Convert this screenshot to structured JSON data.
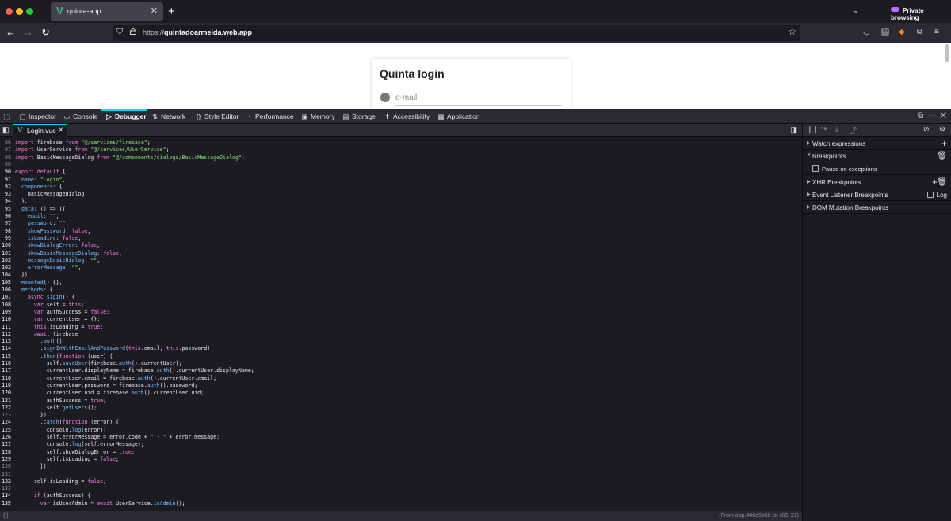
{
  "browser": {
    "tab_title": "quinta-app",
    "new_tab": "+",
    "private_label": "Private browsing",
    "url_prefix": "https://",
    "url_host": "quintadoarmeida.web.app"
  },
  "page": {
    "card_title": "Quinta login",
    "email_placeholder": "e-mail"
  },
  "devtools": {
    "tabs": [
      "Inspector",
      "Console",
      "Debugger",
      "Network",
      "Style Editor",
      "Performance",
      "Memory",
      "Storage",
      "Accessibility",
      "Application"
    ],
    "selected_tab": "Debugger",
    "source_tab": "Login.vue",
    "status_left": "{ }",
    "status_right": "(From app.446e9b68.js)  (88, 21)"
  },
  "right_panel": {
    "watch": "Watch expressions",
    "breakpoints": "Breakpoints",
    "pause_exceptions": "Pause on exceptions",
    "xhr": "XHR Breakpoints",
    "event_listener": "Event Listener Breakpoints",
    "log": "Log",
    "dom_mutation": "DOM Mutation Breakpoints"
  },
  "code": [
    {
      "n": "86",
      "t": "import firebase from \"@/services/firebase\";"
    },
    {
      "n": "87",
      "t": "import UserService from \"@/services/UserService\";"
    },
    {
      "n": "88",
      "t": "import BasicMessageDialog from \"@/components/dialogs/BasicMessageDialog\";"
    },
    {
      "n": "89",
      "t": ""
    },
    {
      "n": "90",
      "t": "export default {"
    },
    {
      "n": "91",
      "t": "  name: \"Login\","
    },
    {
      "n": "92",
      "t": "  components: {"
    },
    {
      "n": "93",
      "t": "    BasicMessageDialog,"
    },
    {
      "n": "94",
      "t": "  },"
    },
    {
      "n": "95",
      "t": "  data: () => ({"
    },
    {
      "n": "96",
      "t": "    email: \"\","
    },
    {
      "n": "97",
      "t": "    password: \"\","
    },
    {
      "n": "98",
      "t": "    showPassword: false,"
    },
    {
      "n": "99",
      "t": "    isLoading: false,"
    },
    {
      "n": "100",
      "t": "    showDialogError: false,"
    },
    {
      "n": "101",
      "t": "    showBasicMessageDialog: false,"
    },
    {
      "n": "102",
      "t": "    messageBasicDialog: \"\","
    },
    {
      "n": "103",
      "t": "    errorMessage: \"\","
    },
    {
      "n": "104",
      "t": "  }),"
    },
    {
      "n": "105",
      "t": "  mounted() {},"
    },
    {
      "n": "106",
      "t": "  methods: {"
    },
    {
      "n": "107",
      "t": "    async sigin() {"
    },
    {
      "n": "108",
      "t": "      var self = this;"
    },
    {
      "n": "109",
      "t": "      var authSuccess = false;"
    },
    {
      "n": "110",
      "t": "      var currentUser = {};"
    },
    {
      "n": "111",
      "t": "      this.isLoading = true;"
    },
    {
      "n": "112",
      "t": "      await firebase"
    },
    {
      "n": "113",
      "t": "        .auth()"
    },
    {
      "n": "114",
      "t": "        .signInWithEmailAndPassword(this.email, this.password)"
    },
    {
      "n": "115",
      "t": "        .then(function (user) {"
    },
    {
      "n": "116",
      "t": "          self.saveUser(firebase.auth().currentUser);"
    },
    {
      "n": "117",
      "t": "          currentUser.displayName = firebase.auth().currentUser.displayName;"
    },
    {
      "n": "118",
      "t": "          currentUser.email = firebase.auth().currentUser.email;"
    },
    {
      "n": "119",
      "t": "          currentUser.password = firebase.auth().password;"
    },
    {
      "n": "120",
      "t": "          currentUser.uid = firebase.auth().currentUser.uid;"
    },
    {
      "n": "121",
      "t": "          authSuccess = true;"
    },
    {
      "n": "122",
      "t": "          self.getUsers();"
    },
    {
      "n": "123",
      "t": "        })"
    },
    {
      "n": "124",
      "t": "        .catch(function (error) {"
    },
    {
      "n": "125",
      "t": "          console.log(error);"
    },
    {
      "n": "126",
      "t": "          self.errorMessage = error.code + \" - \" + error.message;"
    },
    {
      "n": "127",
      "t": "          console.log(self.errorMessage);"
    },
    {
      "n": "128",
      "t": "          self.showDialogError = true;"
    },
    {
      "n": "129",
      "t": "          self.isLoading = false;"
    },
    {
      "n": "130",
      "t": "        });"
    },
    {
      "n": "131",
      "t": ""
    },
    {
      "n": "132",
      "t": "      self.isLoading = false;"
    },
    {
      "n": "133",
      "t": ""
    },
    {
      "n": "134",
      "t": "      if (authSuccess) {"
    },
    {
      "n": "135",
      "t": "        var isUserAdmin = await UserService.isAdmin();"
    }
  ],
  "icons": {
    "back": "back-arrow-icon",
    "forward": "forward-arrow-icon",
    "reload": "reload-icon"
  },
  "colors": {
    "devtools_accent": "#00ddff",
    "vue_green": "#41b883",
    "private_purple": "#c069ff"
  }
}
